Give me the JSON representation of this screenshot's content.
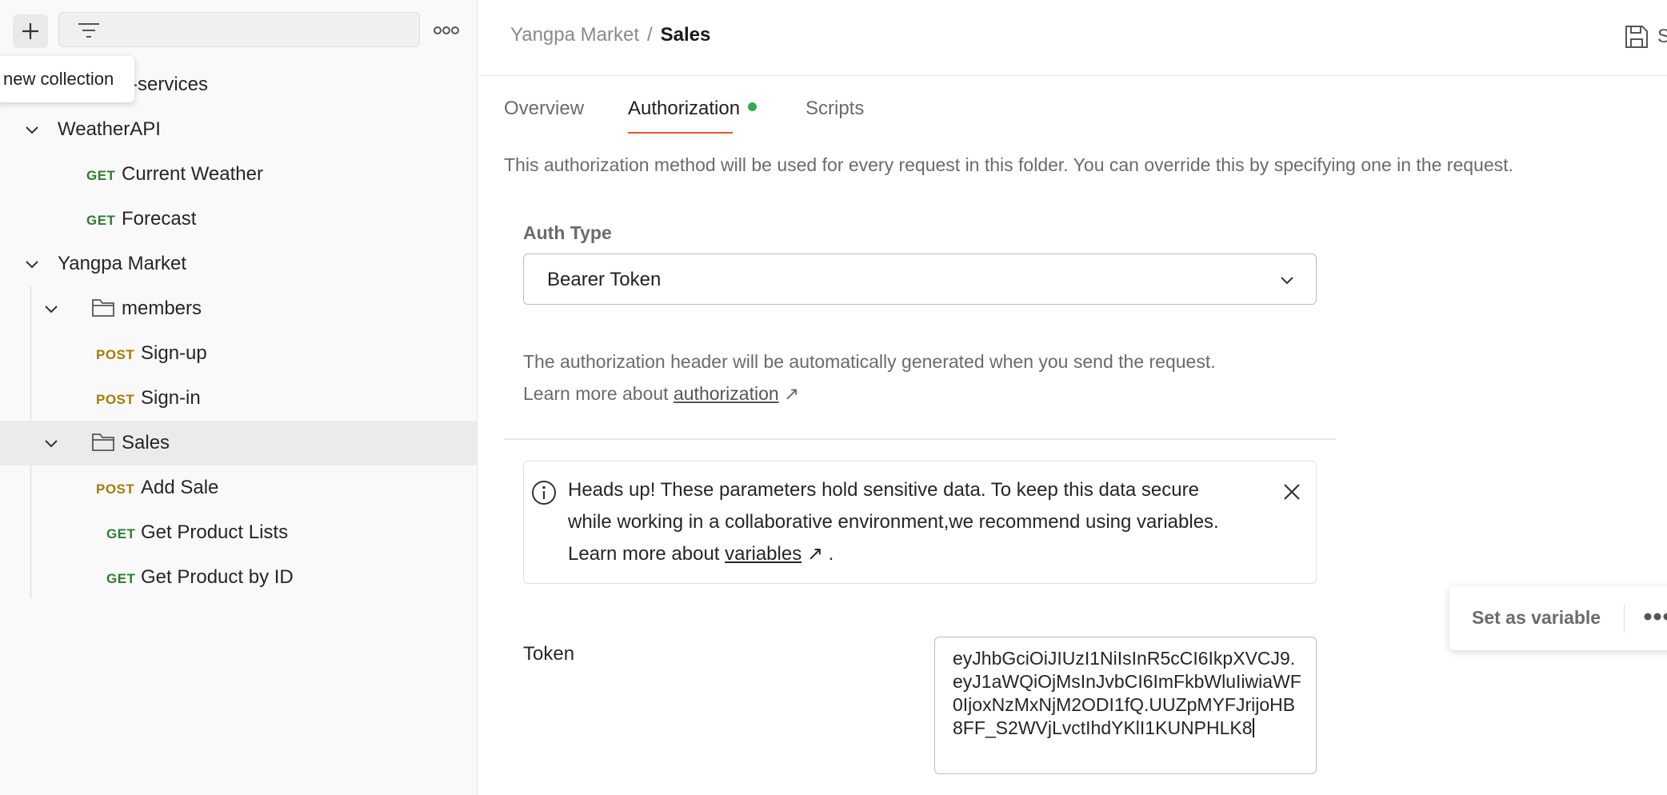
{
  "sidebar": {
    "new_button_icon": "plus-icon",
    "filter_icon": "filter-icon",
    "filter_value": "",
    "more_icon": "more-horizontal-icon",
    "tooltip": "new collection",
    "tree": [
      {
        "label": "-services",
        "kind": "collection"
      },
      {
        "label": "WeatherAPI",
        "kind": "collection",
        "expanded": true
      },
      {
        "method": "GET",
        "label": "Current Weather"
      },
      {
        "method": "GET",
        "label": "Forecast"
      },
      {
        "label": "Yangpa Market",
        "kind": "collection",
        "expanded": true
      },
      {
        "label": "members",
        "kind": "folder",
        "expanded": true
      },
      {
        "method": "POST",
        "label": "Sign-up"
      },
      {
        "method": "POST",
        "label": "Sign-in"
      },
      {
        "label": "Sales",
        "kind": "folder",
        "expanded": true,
        "selected": true
      },
      {
        "method": "POST",
        "label": "Add Sale"
      },
      {
        "method": "GET",
        "label": "Get Product Lists"
      },
      {
        "method": "GET",
        "label": "Get Product by ID"
      }
    ]
  },
  "header": {
    "breadcrumb_parent": "Yangpa Market",
    "breadcrumb_separator": "/",
    "breadcrumb_current": "Sales",
    "save_icon": "save-icon",
    "save_label": "S"
  },
  "tabs": [
    {
      "label": "Overview",
      "active": false
    },
    {
      "label": "Authorization",
      "active": true,
      "indicator": "green-dot"
    },
    {
      "label": "Scripts",
      "active": false
    }
  ],
  "authorization": {
    "description": "This authorization method will be used for every request in this folder. You can override this by specifying one in the request.",
    "auth_type_label": "Auth Type",
    "auth_type_value": "Bearer Token",
    "info_line1": "The authorization header will be automatically generated when you send the request.",
    "info_line2_prefix": "Learn more about",
    "info_link": "authorization",
    "alert": {
      "line1": "Heads up! These parameters hold sensitive data. To keep this data secure",
      "line2": "while working in a collaborative environment,we recommend using variables.",
      "line3_prefix": "Learn more about",
      "link": "variables",
      "suffix": "."
    },
    "popover_label": "Set as variable",
    "token_label": "Token",
    "token_value": "eyJhbGciOiJIUzI1NiIsInR5cCI6IkpXVCJ9.eyJ1aWQiOjMsInJvbCI6ImFkbWluIiwiaWF0IjoxNzMxNjM2ODI1fQ.UUZpMYFJrijoHB8FF_S2WVjLvctIhdYKlI1KUNPHLK8"
  },
  "colors": {
    "accent_underline": "#e8572e",
    "status_dot": "#34a853",
    "get_method": "#2e7d32",
    "post_method": "#a67c00"
  }
}
